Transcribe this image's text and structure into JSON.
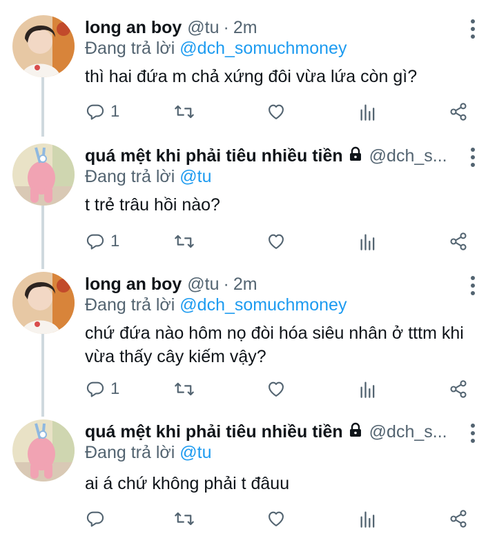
{
  "colors": {
    "link": "#1d9bf0",
    "muted": "#536471",
    "text": "#0f1419",
    "line": "#cfd9de"
  },
  "replying_prefix": "Đang trả lời",
  "tweets": [
    {
      "name": "long an boy",
      "handle": "@tu",
      "dot": "·",
      "time": "2m",
      "reply_to": "@dch_somuchmoney",
      "text": "thì hai đứa m chả xứng đôi vừa lứa còn gì?",
      "reply_count": "1",
      "avatar": "boy-photo"
    },
    {
      "name": "quá mệt khi phải tiêu nhiều tiền",
      "handle": "@dch_s...",
      "reply_to": "@tu",
      "text": "t trẻ trâu hồi nào?",
      "reply_count": "1",
      "avatar": "pink-cartoon",
      "locked": true
    },
    {
      "name": "long an boy",
      "handle": "@tu",
      "dot": "·",
      "time": "2m",
      "reply_to": "@dch_somuchmoney",
      "text": "chứ đứa nào hôm nọ đòi hóa siêu nhân ở tttm khi vừa thấy cây kiếm vậy?",
      "reply_count": "1",
      "avatar": "boy-photo"
    },
    {
      "name": "quá mệt khi phải tiêu nhiều tiền",
      "handle": "@dch_s...",
      "reply_to": "@tu",
      "text": "ai á chứ không phải t đâuu",
      "reply_count": "",
      "avatar": "pink-cartoon",
      "locked": true
    }
  ]
}
